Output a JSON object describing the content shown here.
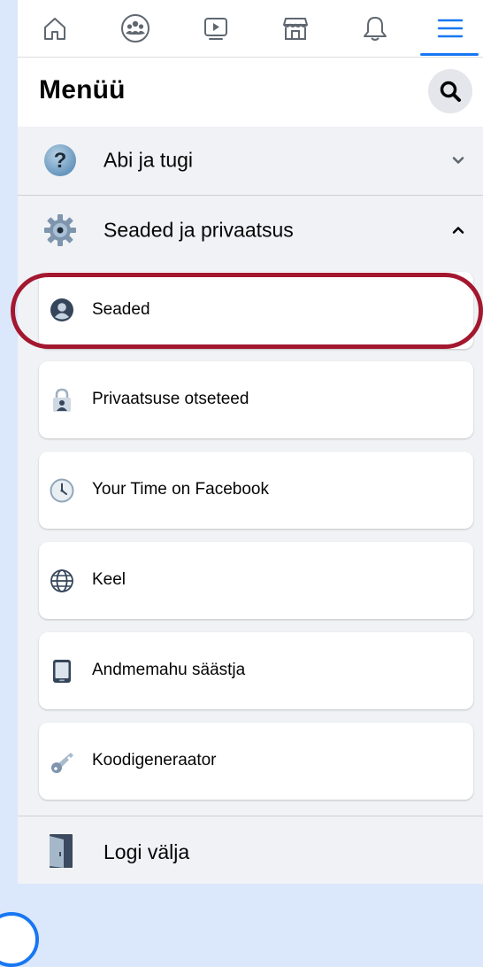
{
  "nav": {
    "icons": [
      "home-icon",
      "groups-icon",
      "watch-icon",
      "marketplace-icon",
      "notifications-icon",
      "menu-icon"
    ],
    "active": "menu-icon",
    "accent": "#1877f2"
  },
  "header": {
    "title": "Menüü",
    "search_icon": "search-icon"
  },
  "sections": {
    "help": {
      "label": "Abi ja tugi",
      "icon": "question-icon",
      "state": "collapsed"
    },
    "settings_privacy": {
      "label": "Seaded ja privaatsus",
      "icon": "gear-icon",
      "state": "expanded"
    }
  },
  "submenu": [
    {
      "label": "Seaded",
      "icon": "profile-circle-icon"
    },
    {
      "label": "Privaatsuse otseteed",
      "icon": "lock-person-icon"
    },
    {
      "label": "Your Time on Facebook",
      "icon": "clock-icon"
    },
    {
      "label": "Keel",
      "icon": "globe-icon"
    },
    {
      "label": "Andmemahu säästja",
      "icon": "phone-icon"
    },
    {
      "label": "Koodigeneraator",
      "icon": "key-icon"
    }
  ],
  "highlight_color": "#a3182f",
  "logout": {
    "label": "Logi välja",
    "icon": "door-icon"
  }
}
